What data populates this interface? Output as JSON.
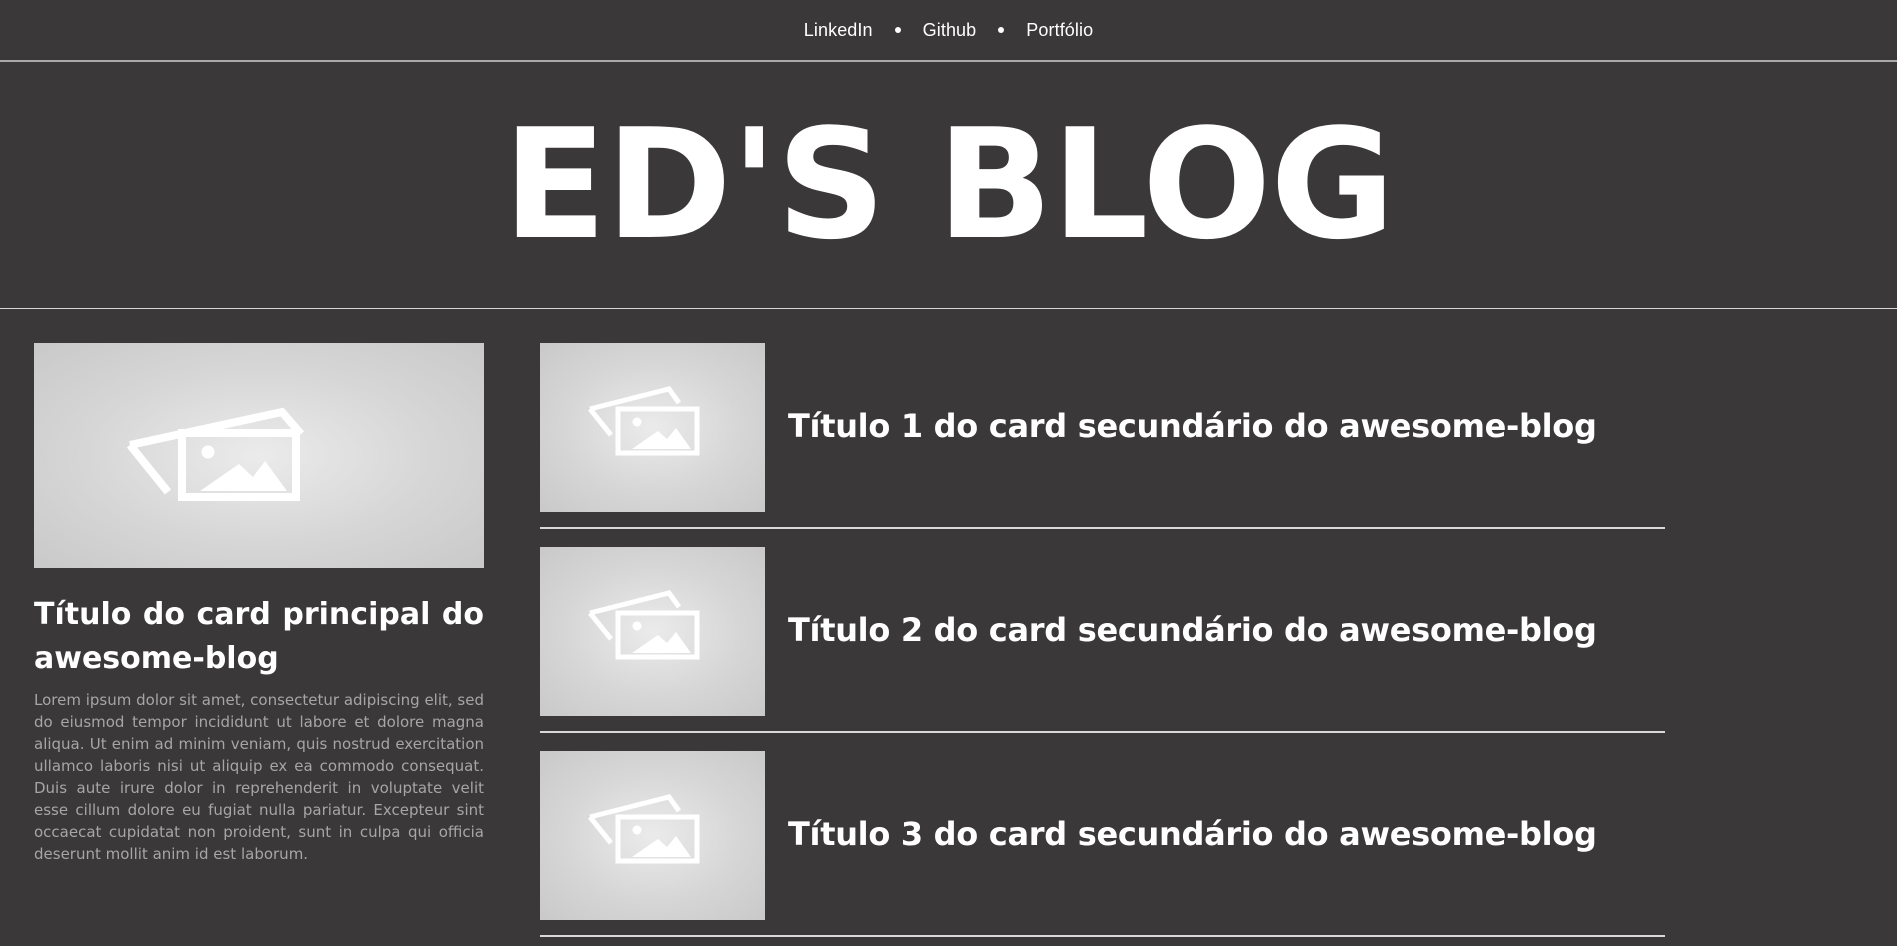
{
  "nav": {
    "links": [
      "LinkedIn",
      "Github",
      "Portfólio"
    ]
  },
  "header": {
    "title": "ED'S BLOG"
  },
  "main_card": {
    "title": "Título do card principal do awesome-blog",
    "text": "Lorem ipsum dolor sit amet, consectetur adipiscing elit, sed do eiusmod tempor incididunt ut labore et dolore magna aliqua. Ut enim ad minim veniam, quis nostrud exercitation ullamco laboris nisi ut aliquip ex ea commodo consequat. Duis aute irure dolor in reprehenderit in voluptate velit esse cillum dolore eu fugiat nulla pariatur. Excepteur sint occaecat cupidatat non proident, sunt in culpa qui officia deserunt mollit anim id est laborum.",
    "image_icon": "image-placeholder-icon"
  },
  "secondary_cards": [
    {
      "title": "Título 1 do card secundário do awesome-blog",
      "image_icon": "image-placeholder-icon"
    },
    {
      "title": "Título 2 do card secundário do awesome-blog",
      "image_icon": "image-placeholder-icon"
    },
    {
      "title": "Título 3 do card secundário do awesome-blog",
      "image_icon": "image-placeholder-icon"
    }
  ],
  "colors": {
    "background": "#3a3839",
    "text": "#ffffff",
    "muted_text": "#a6a6a6",
    "divider": "#d9d9d9",
    "placeholder": "#d6d6d6"
  }
}
